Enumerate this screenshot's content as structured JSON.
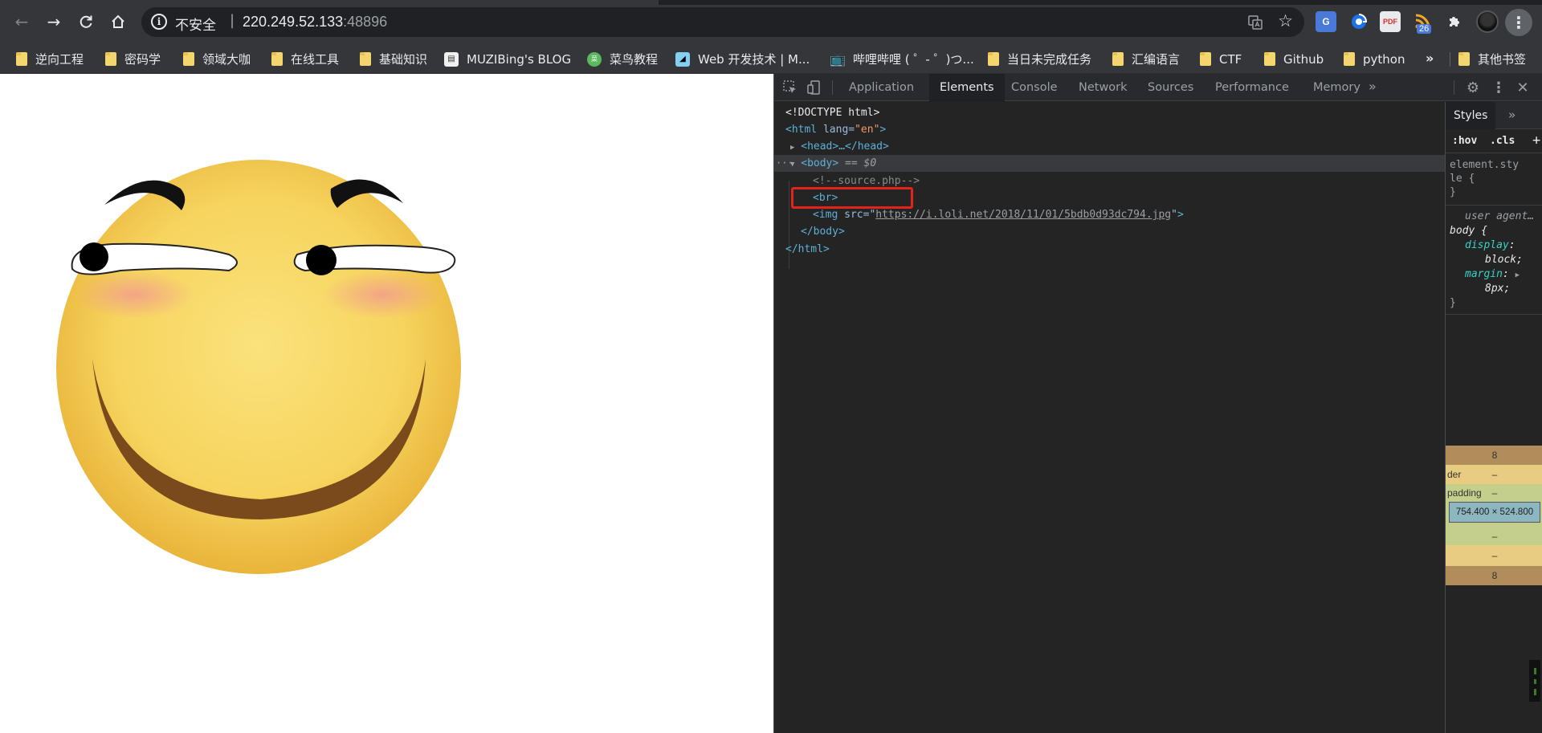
{
  "browser": {
    "address": {
      "security_label": "不安全",
      "separator": "|",
      "host": "220.249.52.133",
      "port": ":48896"
    },
    "extensions": {
      "translate": "G",
      "pdf": "PDF",
      "rss_badge": "26"
    }
  },
  "bookmarks": {
    "items": [
      {
        "label": "逆向工程",
        "icon": "folder-icon"
      },
      {
        "label": "密码学",
        "icon": "folder-icon"
      },
      {
        "label": "领域大咖",
        "icon": "folder-icon"
      },
      {
        "label": "在线工具",
        "icon": "folder-icon"
      },
      {
        "label": "基础知识",
        "icon": "folder-icon"
      },
      {
        "label": "MUZIBing's BLOG",
        "icon": "site-favicon"
      },
      {
        "label": "菜鸟教程",
        "icon": "runoob-favicon"
      },
      {
        "label": "Web 开发技术 | M...",
        "icon": "mdn-favicon"
      },
      {
        "label": "哔哩哔哩 ( ゜- ゜)つ...",
        "icon": "bilibili-favicon"
      },
      {
        "label": "当日未完成任务",
        "icon": "folder-icon"
      },
      {
        "label": "汇编语言",
        "icon": "folder-icon"
      },
      {
        "label": "CTF",
        "icon": "folder-icon"
      },
      {
        "label": "Github",
        "icon": "folder-icon"
      },
      {
        "label": "python",
        "icon": "folder-icon"
      }
    ],
    "more": "»",
    "other": "其他书签"
  },
  "devtools": {
    "tabs": [
      "Application",
      "Elements",
      "Console",
      "Network",
      "Sources",
      "Performance",
      "Memory"
    ],
    "active_tab": "Elements",
    "more_tabs": "»",
    "dom": {
      "doctype": "<!DOCTYPE html>",
      "html_open_tag": "<html",
      "html_lang_attr": "lang",
      "html_lang_val": "\"en\"",
      "head": "<head>…</head>",
      "body_open": "<body>",
      "body_marker": "== $0",
      "comment": "<!--source.php-->",
      "br": "<br>",
      "img_open": "<img",
      "img_src_attr": "src",
      "img_src": "https://i.loli.net/2018/11/01/5bdb0d93dc794.jpg",
      "body_close": "</body>",
      "html_close": "</html>"
    },
    "styles": {
      "tab": "Styles",
      "hov": ":hov",
      "cls": ".cls",
      "element_style_1": "element.sty",
      "element_style_2": "le {",
      "close_brace": "}",
      "user_agent": "user agent…",
      "body_selector": "body {",
      "display_prop": "display",
      "display_val": "block;",
      "margin_prop": "margin",
      "margin_val": "8px;",
      "box_margin": "8",
      "box_border_label": "der",
      "box_border_val": "–",
      "box_padding_label": "padding",
      "box_padding_val": "–",
      "box_content": "754.400 × 524.800"
    }
  }
}
